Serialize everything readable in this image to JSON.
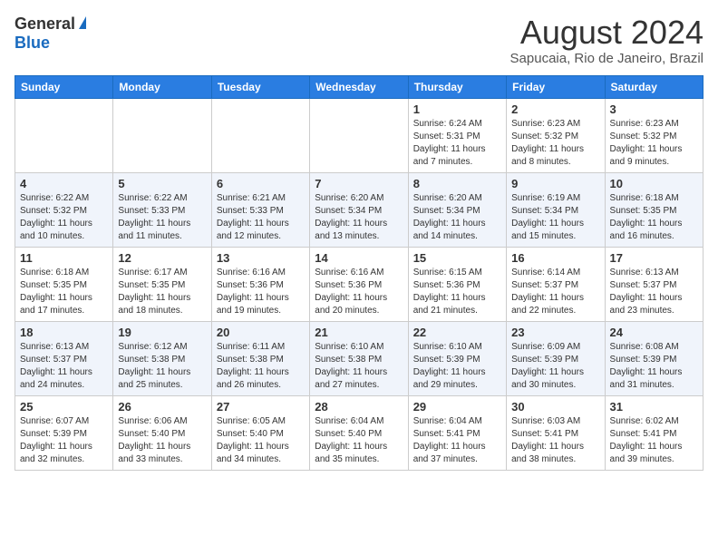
{
  "logo": {
    "general": "General",
    "blue": "Blue"
  },
  "title": "August 2024",
  "subtitle": "Sapucaia, Rio de Janeiro, Brazil",
  "headers": [
    "Sunday",
    "Monday",
    "Tuesday",
    "Wednesday",
    "Thursday",
    "Friday",
    "Saturday"
  ],
  "weeks": [
    [
      {
        "day": "",
        "info": ""
      },
      {
        "day": "",
        "info": ""
      },
      {
        "day": "",
        "info": ""
      },
      {
        "day": "",
        "info": ""
      },
      {
        "day": "1",
        "info": "Sunrise: 6:24 AM\nSunset: 5:31 PM\nDaylight: 11 hours\nand 7 minutes."
      },
      {
        "day": "2",
        "info": "Sunrise: 6:23 AM\nSunset: 5:32 PM\nDaylight: 11 hours\nand 8 minutes."
      },
      {
        "day": "3",
        "info": "Sunrise: 6:23 AM\nSunset: 5:32 PM\nDaylight: 11 hours\nand 9 minutes."
      }
    ],
    [
      {
        "day": "4",
        "info": "Sunrise: 6:22 AM\nSunset: 5:32 PM\nDaylight: 11 hours\nand 10 minutes."
      },
      {
        "day": "5",
        "info": "Sunrise: 6:22 AM\nSunset: 5:33 PM\nDaylight: 11 hours\nand 11 minutes."
      },
      {
        "day": "6",
        "info": "Sunrise: 6:21 AM\nSunset: 5:33 PM\nDaylight: 11 hours\nand 12 minutes."
      },
      {
        "day": "7",
        "info": "Sunrise: 6:20 AM\nSunset: 5:34 PM\nDaylight: 11 hours\nand 13 minutes."
      },
      {
        "day": "8",
        "info": "Sunrise: 6:20 AM\nSunset: 5:34 PM\nDaylight: 11 hours\nand 14 minutes."
      },
      {
        "day": "9",
        "info": "Sunrise: 6:19 AM\nSunset: 5:34 PM\nDaylight: 11 hours\nand 15 minutes."
      },
      {
        "day": "10",
        "info": "Sunrise: 6:18 AM\nSunset: 5:35 PM\nDaylight: 11 hours\nand 16 minutes."
      }
    ],
    [
      {
        "day": "11",
        "info": "Sunrise: 6:18 AM\nSunset: 5:35 PM\nDaylight: 11 hours\nand 17 minutes."
      },
      {
        "day": "12",
        "info": "Sunrise: 6:17 AM\nSunset: 5:35 PM\nDaylight: 11 hours\nand 18 minutes."
      },
      {
        "day": "13",
        "info": "Sunrise: 6:16 AM\nSunset: 5:36 PM\nDaylight: 11 hours\nand 19 minutes."
      },
      {
        "day": "14",
        "info": "Sunrise: 6:16 AM\nSunset: 5:36 PM\nDaylight: 11 hours\nand 20 minutes."
      },
      {
        "day": "15",
        "info": "Sunrise: 6:15 AM\nSunset: 5:36 PM\nDaylight: 11 hours\nand 21 minutes."
      },
      {
        "day": "16",
        "info": "Sunrise: 6:14 AM\nSunset: 5:37 PM\nDaylight: 11 hours\nand 22 minutes."
      },
      {
        "day": "17",
        "info": "Sunrise: 6:13 AM\nSunset: 5:37 PM\nDaylight: 11 hours\nand 23 minutes."
      }
    ],
    [
      {
        "day": "18",
        "info": "Sunrise: 6:13 AM\nSunset: 5:37 PM\nDaylight: 11 hours\nand 24 minutes."
      },
      {
        "day": "19",
        "info": "Sunrise: 6:12 AM\nSunset: 5:38 PM\nDaylight: 11 hours\nand 25 minutes."
      },
      {
        "day": "20",
        "info": "Sunrise: 6:11 AM\nSunset: 5:38 PM\nDaylight: 11 hours\nand 26 minutes."
      },
      {
        "day": "21",
        "info": "Sunrise: 6:10 AM\nSunset: 5:38 PM\nDaylight: 11 hours\nand 27 minutes."
      },
      {
        "day": "22",
        "info": "Sunrise: 6:10 AM\nSunset: 5:39 PM\nDaylight: 11 hours\nand 29 minutes."
      },
      {
        "day": "23",
        "info": "Sunrise: 6:09 AM\nSunset: 5:39 PM\nDaylight: 11 hours\nand 30 minutes."
      },
      {
        "day": "24",
        "info": "Sunrise: 6:08 AM\nSunset: 5:39 PM\nDaylight: 11 hours\nand 31 minutes."
      }
    ],
    [
      {
        "day": "25",
        "info": "Sunrise: 6:07 AM\nSunset: 5:39 PM\nDaylight: 11 hours\nand 32 minutes."
      },
      {
        "day": "26",
        "info": "Sunrise: 6:06 AM\nSunset: 5:40 PM\nDaylight: 11 hours\nand 33 minutes."
      },
      {
        "day": "27",
        "info": "Sunrise: 6:05 AM\nSunset: 5:40 PM\nDaylight: 11 hours\nand 34 minutes."
      },
      {
        "day": "28",
        "info": "Sunrise: 6:04 AM\nSunset: 5:40 PM\nDaylight: 11 hours\nand 35 minutes."
      },
      {
        "day": "29",
        "info": "Sunrise: 6:04 AM\nSunset: 5:41 PM\nDaylight: 11 hours\nand 37 minutes."
      },
      {
        "day": "30",
        "info": "Sunrise: 6:03 AM\nSunset: 5:41 PM\nDaylight: 11 hours\nand 38 minutes."
      },
      {
        "day": "31",
        "info": "Sunrise: 6:02 AM\nSunset: 5:41 PM\nDaylight: 11 hours\nand 39 minutes."
      }
    ]
  ]
}
